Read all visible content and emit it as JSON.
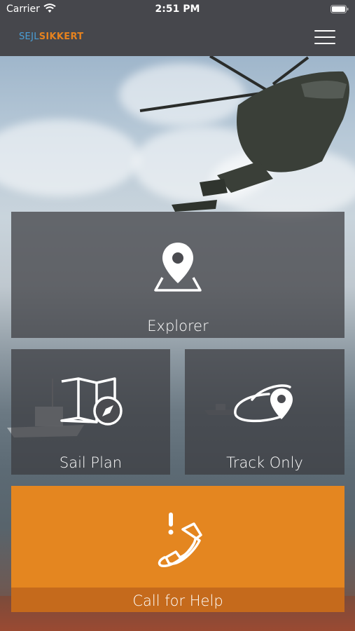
{
  "status_bar": {
    "carrier": "Carrier",
    "time": "2:51 PM"
  },
  "nav": {
    "logo_part1": "SEJL",
    "logo_part2": "SIKKERT",
    "menu_icon": "hamburger-menu-icon"
  },
  "tiles": {
    "explorer": {
      "label": "Explorer",
      "icon": "map-pin-icon"
    },
    "sail_plan": {
      "label": "Sail Plan",
      "icon": "map-compass-icon"
    },
    "track_only": {
      "label": "Track Only",
      "icon": "orbit-pin-icon"
    },
    "call_for_help": {
      "label": "Call for Help",
      "icon": "phone-alert-icon"
    }
  },
  "colors": {
    "nav_bg": "#46474c",
    "accent_orange": "#e48620",
    "logo_blue": "#4a9fd8"
  }
}
